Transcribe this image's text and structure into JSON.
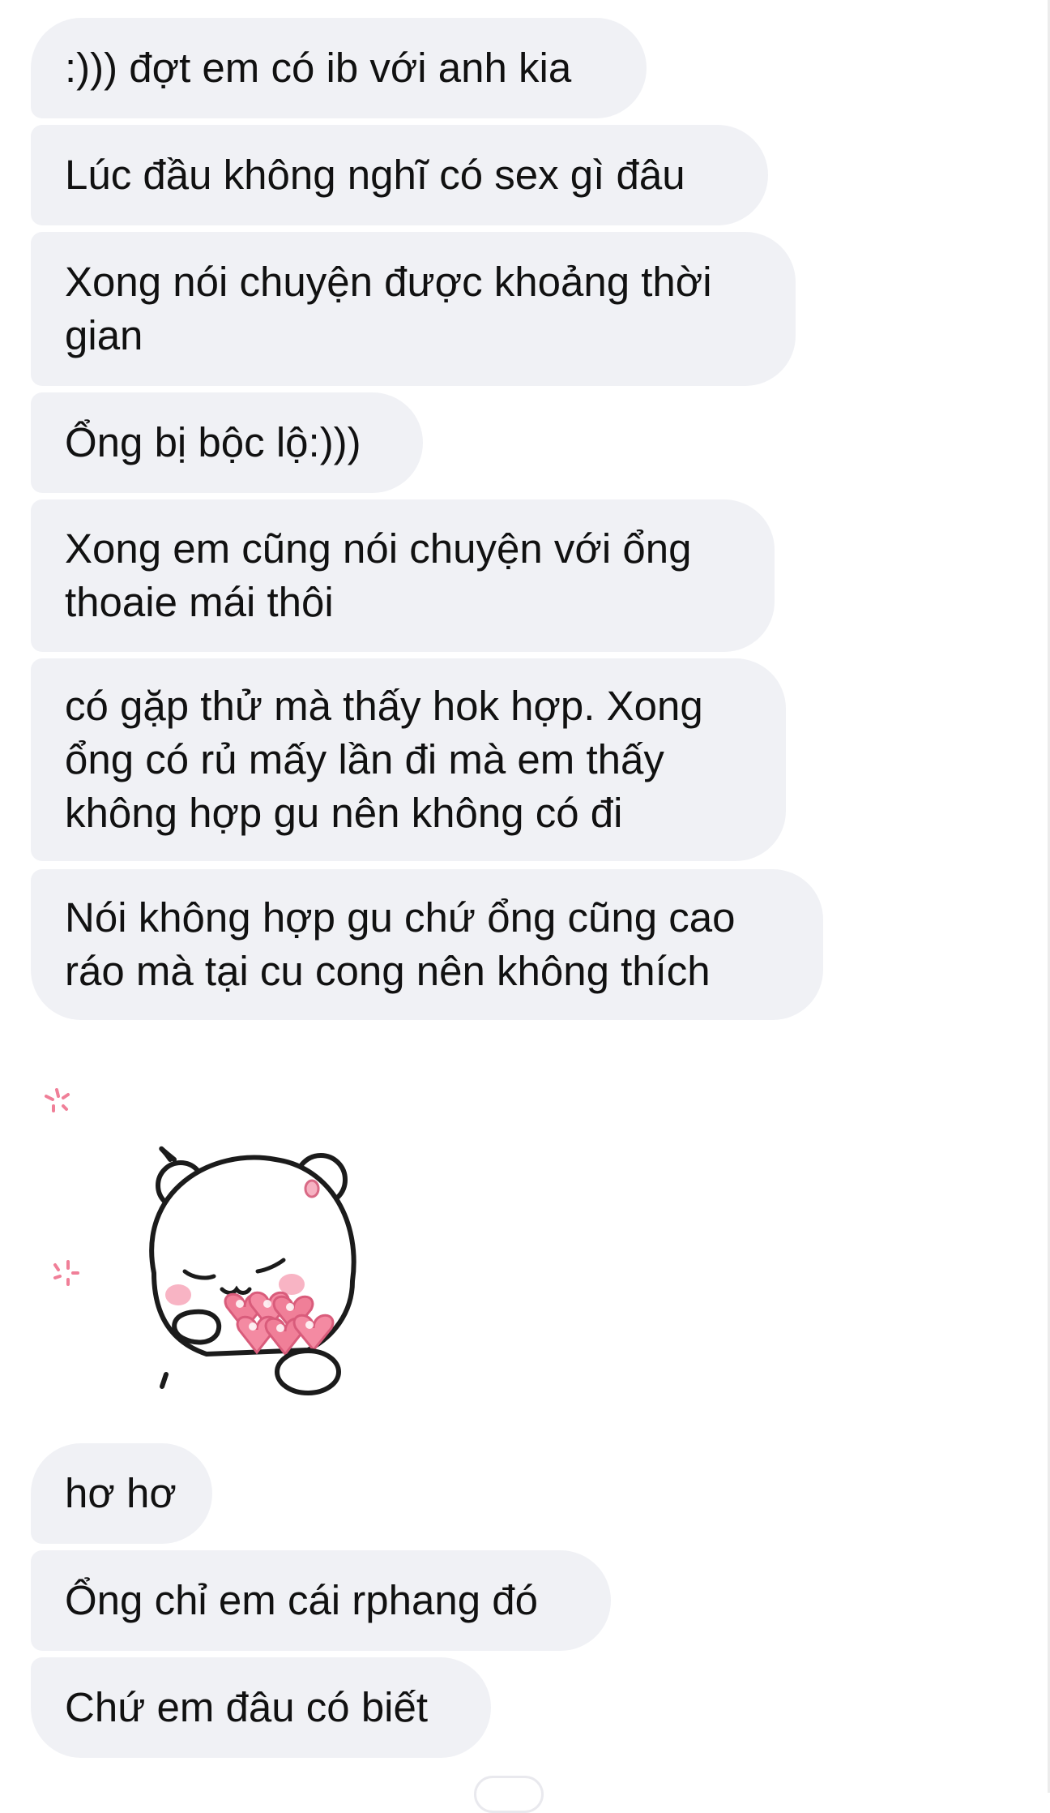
{
  "messages": [
    {
      "text": ":))) đợt em có ib với anh kia"
    },
    {
      "text": "Lúc đầu không nghĩ có sex gì đâu"
    },
    {
      "text": "Xong nói chuyện được khoảng thời\ngian"
    },
    {
      "text": "Ổng bị bộc lộ:)))"
    },
    {
      "text": "Xong em cũng nói chuyện với ổng\nthoaie mái thôi"
    },
    {
      "text": "có gặp thử mà thấy hok hợp. Xong\nổng có rủ mấy lần đi mà em thấy\nkhông hợp gu nên không có đi"
    },
    {
      "text": "Nói không hợp gu chứ ổng cũng cao\nráo mà tại cu cong nên không thích"
    },
    {
      "text": "hơ hơ"
    },
    {
      "text": "Ổng chỉ em cái rphang đó"
    },
    {
      "text": "Chứ em đâu có biết"
    }
  ],
  "sticker": {
    "icon": "bear-with-hearts-sticker"
  },
  "colors": {
    "bubble_bg": "#f0f1f5",
    "text": "#111111",
    "heart_pink": "#f07f98",
    "heart_light": "#f8b4c4"
  }
}
